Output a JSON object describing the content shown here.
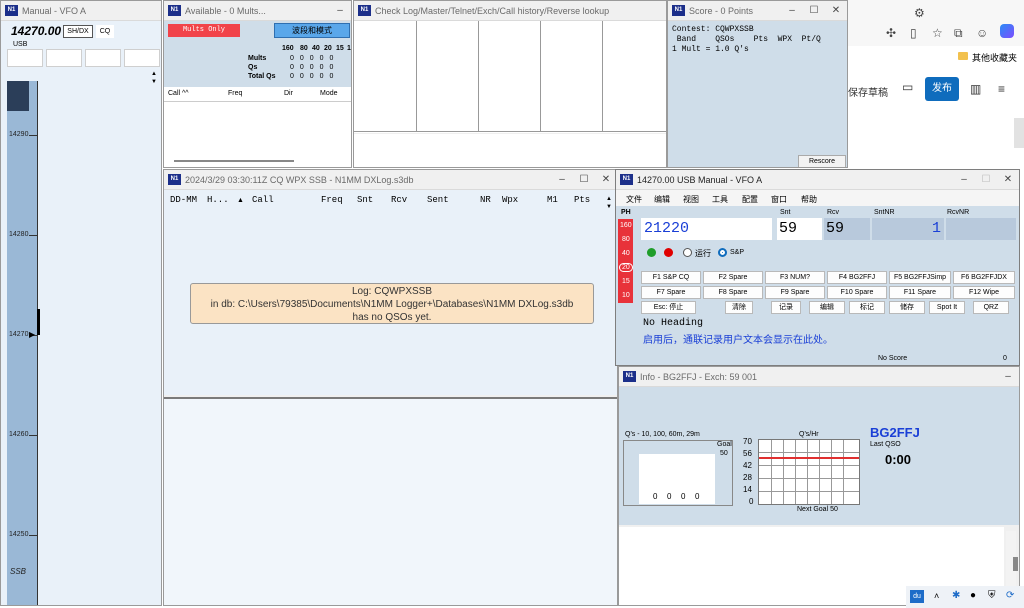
{
  "vfo_window": {
    "title": "Manual - VFO A",
    "freq": "14270.00",
    "sh_dx": "SH/DX",
    "cq": "CQ",
    "mode": "USB",
    "scale": [
      "14290",
      "14280",
      "14270",
      "14260",
      "14250"
    ],
    "bottom_mode": "SSB"
  },
  "avail_window": {
    "title": "Available - 0 Mults...",
    "mults_only": "Mults Only",
    "band_mode_btn": "波段和模式",
    "bands": [
      "160",
      "80",
      "40",
      "20",
      "15",
      "1"
    ],
    "rows": [
      {
        "label": "Mults",
        "vals": [
          "0",
          "0",
          "0",
          "0",
          "0"
        ]
      },
      {
        "label": "Qs",
        "vals": [
          "0",
          "0",
          "0",
          "0",
          "0"
        ]
      },
      {
        "label": "Total Qs",
        "vals": [
          "0",
          "0",
          "0",
          "0",
          "0"
        ]
      }
    ],
    "cols": [
      "Call ^^",
      "Freq",
      "Dir",
      "Mode"
    ]
  },
  "check_window": {
    "title": "Check Log/Master/Telnet/Exch/Call history/Reverse lookup"
  },
  "score_window": {
    "title": "Score - 0 Points",
    "contest_line": "Contest: CQWPXSSB",
    "header_line": " Band    QSOs    Pts  WPX  Pt/Q",
    "mult_line": "1 Mult = 1.0 Q's",
    "rescore": "Rescore"
  },
  "log_window": {
    "title": "2024/3/29 03:30:11Z  CQ WPX SSB - N1MM DXLog.s3db",
    "cols": [
      "DD-MM",
      "H...",
      "Call",
      "Freq",
      "Snt",
      "Rcv",
      "Sent",
      "NR",
      "Wpx",
      "M1",
      "Pts"
    ],
    "msg1": "Log: CQWPXSSB",
    "msg2": "in db: C:\\Users\\79385\\Documents\\N1MM Logger+\\Databases\\N1MM DXLog.s3db",
    "msg3": "has no QSOs yet."
  },
  "entry_window": {
    "title": "14270.00 USB Manual - VFO A",
    "menu": [
      "文件",
      "编辑",
      "视图",
      "工具",
      "配置",
      "窗口",
      "帮助"
    ],
    "ph": "PH",
    "bands": [
      "160",
      "80",
      "40",
      "20",
      "15",
      "10"
    ],
    "lbl_snt": "Snt",
    "lbl_rcv": "Rcv",
    "lbl_sntnr": "SntNR",
    "lbl_rcvnr": "RcvNR",
    "call_value": "21220",
    "snt_value": "59",
    "rcv_value": "59",
    "sntnr_value": "1",
    "rcvnr_value": "",
    "run_label": "运行",
    "sp_label": "S&P",
    "fkeys_row1": [
      "F1 S&P CQ",
      "F2 Spare",
      "F3 NUM?",
      "F4 BG2FFJ",
      "F5 BG2FFJSimp",
      "F6 BG2FFJDX"
    ],
    "fkeys_row2": [
      "F7 Spare",
      "F8 Spare",
      "F9 Spare",
      "F10 Spare",
      "F11 Spare",
      "F12 Wipe"
    ],
    "actions": [
      "Esc: 停止",
      "清除",
      "记录",
      "编辑",
      "标记",
      "储存",
      "Spot It",
      "QRZ"
    ],
    "heading": "No Heading",
    "hint": "启用后，通联记录用户文本会显示在此处。",
    "no_score": "No Score",
    "zero": "0"
  },
  "info_window": {
    "title": "Info - BG2FFJ - Exch: 59 001",
    "qs_title": "Q's - 10, 100, 60m, 29m",
    "goal_label": "Goal",
    "goal_value": "50",
    "qs_vals": [
      "0",
      "0",
      "0",
      "0"
    ],
    "rate_title": "Q's/Hr",
    "rate_axis": [
      "70",
      "56",
      "42",
      "28",
      "14",
      "0"
    ],
    "next_goal": "Next Goal 50",
    "callsign": "BG2FFJ",
    "last_qso_label": "Last QSO",
    "last_qso_time": "0:00"
  },
  "browser": {
    "favorites": "其他收藏夹",
    "save_draft": "保存草稿",
    "publish": "发布"
  },
  "colors": {
    "accent_blue": "#0f6cbd",
    "mults_red": "#f1434a",
    "band_red": "#e8323a",
    "callsign_blue": "#1a3fd6",
    "scale_blue": "#9ab8d6"
  }
}
